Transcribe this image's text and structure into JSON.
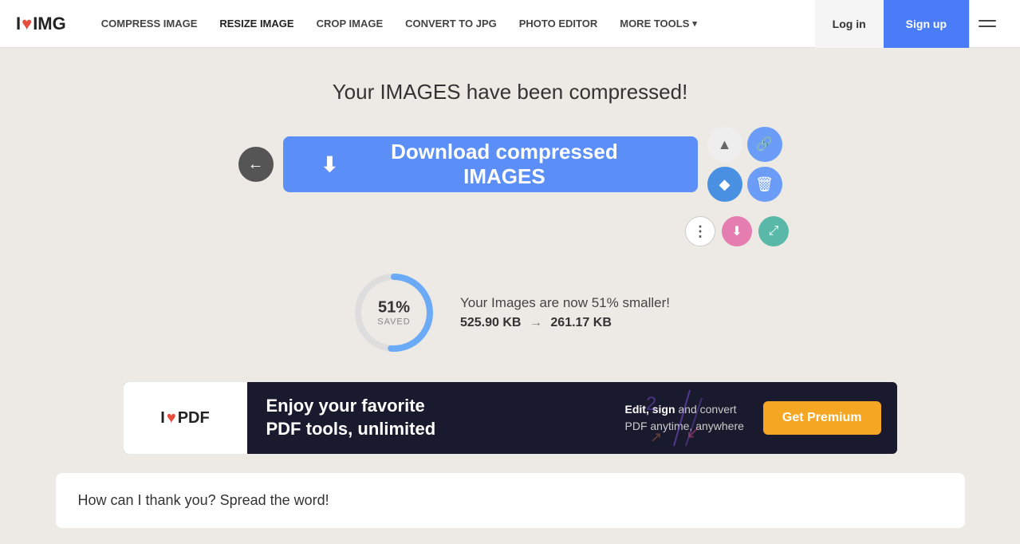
{
  "navbar": {
    "logo_i": "I",
    "logo_heart": "♥",
    "logo_img": "IMG",
    "links": [
      {
        "label": "COMPRESS IMAGE",
        "name": "compress-image"
      },
      {
        "label": "RESIZE IMAGE",
        "name": "resize-image"
      },
      {
        "label": "CROP IMAGE",
        "name": "crop-image"
      },
      {
        "label": "CONVERT TO JPG",
        "name": "convert-to-jpg"
      },
      {
        "label": "PHOTO EDITOR",
        "name": "photo-editor"
      },
      {
        "label": "MORE TOOLS",
        "name": "more-tools"
      }
    ],
    "login_label": "Log in",
    "signup_label": "Sign up"
  },
  "main": {
    "title": "Your IMAGES have been compressed!",
    "download_btn_label": "Download compressed IMAGES",
    "stats": {
      "percent": "51%",
      "saved_label": "SAVED",
      "description": "Your Images are now 51% smaller!",
      "original_size": "525.90 KB",
      "arrow": "→",
      "compressed_size": "261.17 KB"
    }
  },
  "ad": {
    "logo_i": "I",
    "logo_heart": "♥",
    "logo_pdf": "PDF",
    "title_line1": "Enjoy your favorite",
    "title_line2": "PDF tools, unlimited",
    "sub_line1_bold": "Edit, sign",
    "sub_line1_rest": " and convert",
    "sub_line2": "PDF anytime, anywhere",
    "btn_label": "Get Premium"
  },
  "spread": {
    "title": "How can I thank you? Spread the word!"
  },
  "icons": {
    "back": "←",
    "download": "⬇",
    "drive": "▲",
    "link": "🔗",
    "dropbox": "◆",
    "trash": "🗑",
    "dots": "⋮",
    "save_small": "⬇",
    "resize_small": "⤢"
  },
  "colors": {
    "accent_blue": "#5b8ef7",
    "ad_orange": "#f5a623",
    "ad_bg": "#1a1a2e"
  }
}
